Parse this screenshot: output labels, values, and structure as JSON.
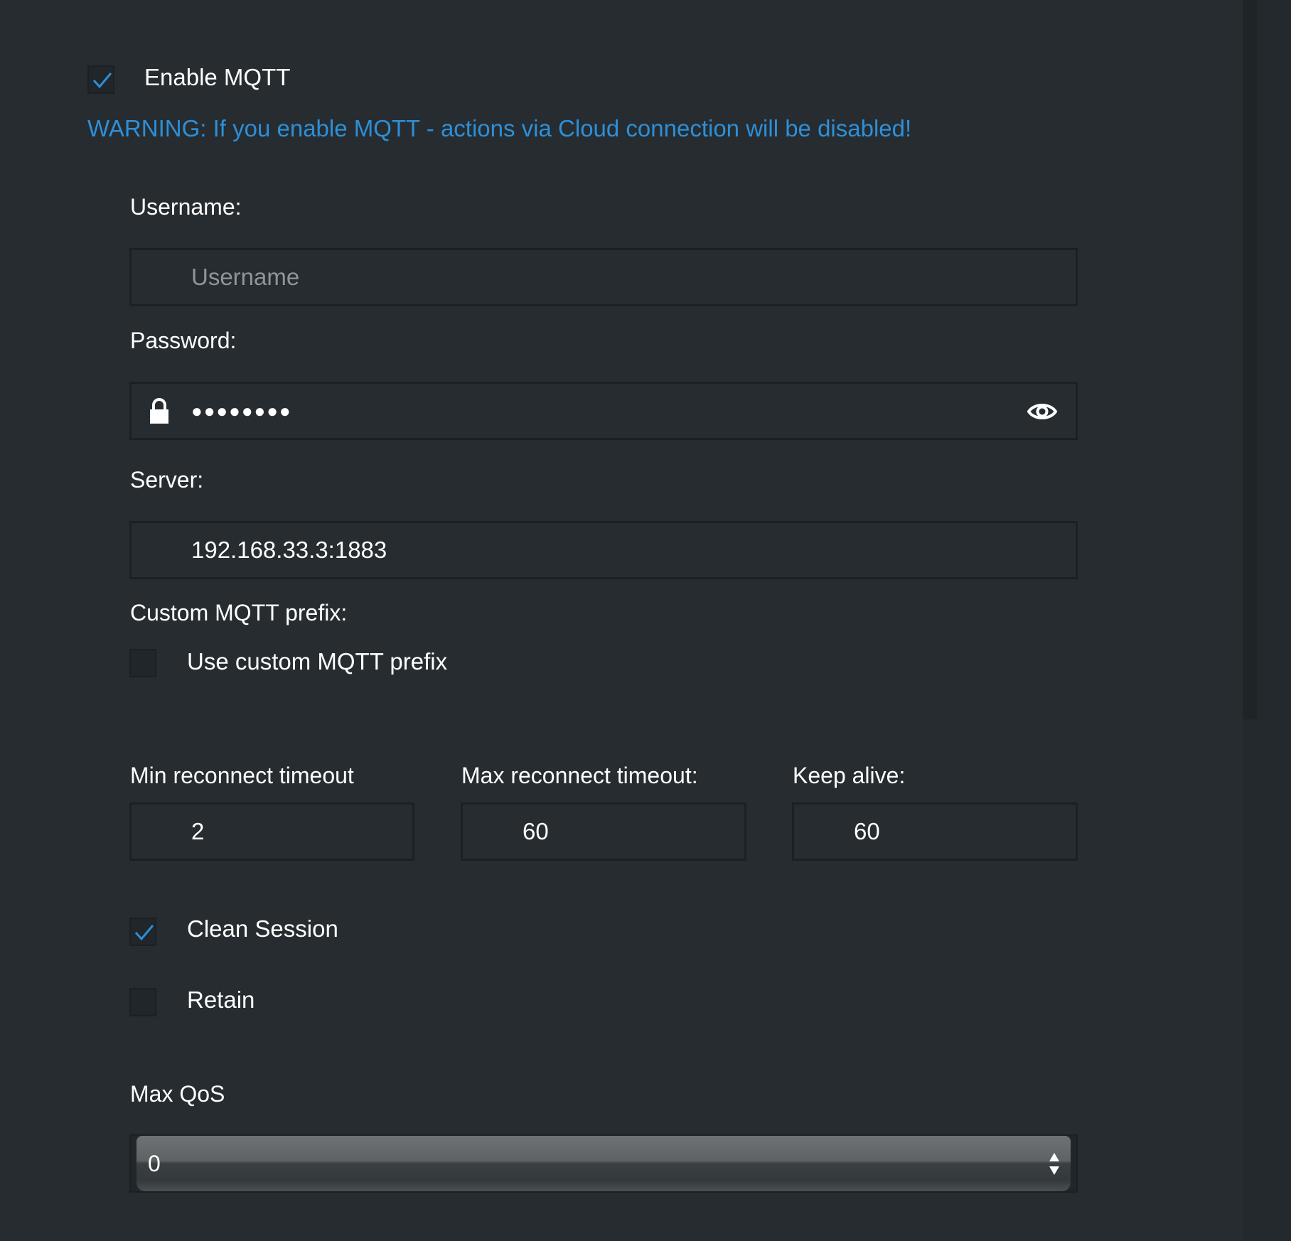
{
  "mqtt": {
    "enable_label": "Enable MQTT",
    "enabled": true,
    "warning": "WARNING: If you enable MQTT - actions via Cloud connection will be disabled!"
  },
  "username": {
    "label": "Username:",
    "placeholder": "Username",
    "value": ""
  },
  "password": {
    "label": "Password:",
    "masked_value": "●●●●●●●●",
    "lock_icon": "lock-icon",
    "reveal_icon": "eye-icon"
  },
  "server": {
    "label": "Server:",
    "value": "192.168.33.3:1883"
  },
  "prefix": {
    "label": "Custom MQTT prefix:",
    "checkbox_label": "Use custom MQTT prefix",
    "checked": false
  },
  "timeouts": {
    "min_label": "Min reconnect timeout",
    "min_value": "2",
    "max_label": "Max reconnect timeout:",
    "max_value": "60",
    "keepalive_label": "Keep alive:",
    "keepalive_value": "60"
  },
  "options": {
    "clean_session_label": "Clean Session",
    "clean_session_checked": true,
    "retain_label": "Retain",
    "retain_checked": false
  },
  "qos": {
    "label": "Max QoS",
    "selected": "0"
  },
  "colors": {
    "background": "#262c30",
    "accent": "#2e8fd8",
    "field_border": "#1b2023"
  }
}
